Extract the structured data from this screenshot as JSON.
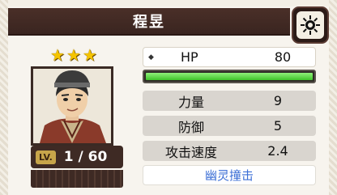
{
  "character": {
    "name": "程昱",
    "stars": [
      "★",
      "★",
      "★"
    ],
    "level_label": "LV.",
    "level_value": "1 / 60"
  },
  "stats": {
    "hp_label": "HP",
    "hp_value": "80",
    "hp_fill": 1.0,
    "rows": [
      {
        "label": "力量",
        "value": "9"
      },
      {
        "label": "防御",
        "value": "5"
      },
      {
        "label": "攻击速度",
        "value": "2.4"
      }
    ],
    "skill": "幽灵撞击"
  },
  "icons": {
    "settings": "sun-gear-icon",
    "hp_bullet": "diamond-bullet-icon"
  },
  "colors": {
    "title_bar": "#3a2520",
    "hp_bar": "#4fd13a",
    "skill_text": "#3c6fd6",
    "star": "#f5c400"
  }
}
